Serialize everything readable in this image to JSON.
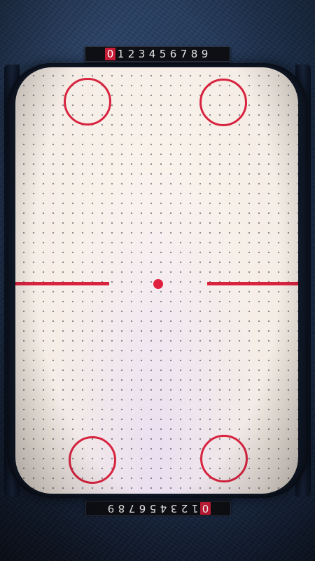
{
  "game": {
    "screen": "air-hockey-table"
  },
  "colors": {
    "accent_red": "#d8233f",
    "table_surface": "#f6efe8",
    "background_blue": "#1c2e4b",
    "scoreboard_bg": "#0e0f14"
  },
  "scoreboards": {
    "top": {
      "digits": [
        "0",
        "1",
        "2",
        "3",
        "4",
        "5",
        "6",
        "7",
        "8",
        "9"
      ],
      "current_score": 0
    },
    "bottom": {
      "digits": [
        "0",
        "1",
        "2",
        "3",
        "4",
        "5",
        "6",
        "7",
        "8",
        "9"
      ],
      "current_score": 0
    }
  }
}
